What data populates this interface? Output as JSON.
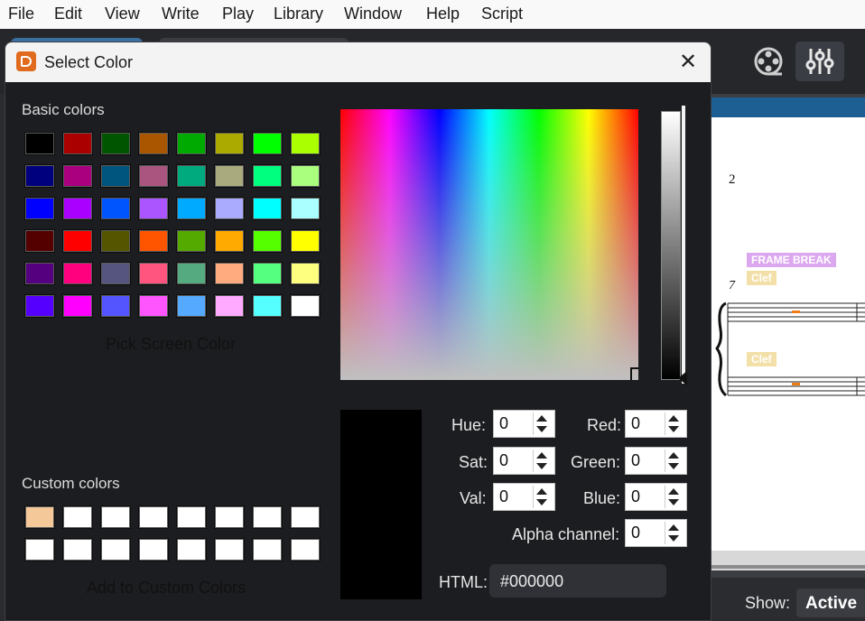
{
  "menubar": {
    "items": [
      "File",
      "Edit",
      "View",
      "Write",
      "Play",
      "Library",
      "Window",
      "Help",
      "Script"
    ]
  },
  "dialog": {
    "title": "Select Color",
    "close_icon": "close-icon",
    "basic_colors_label": "Basic colors",
    "basic_colors": [
      [
        "#000000",
        "#aa0000",
        "#005500",
        "#aa5500",
        "#00aa00",
        "#aaaa00",
        "#00ff00",
        "#aaff00"
      ],
      [
        "#00007f",
        "#aa007f",
        "#00557f",
        "#aa557f",
        "#00aa7f",
        "#aaaa7f",
        "#00ff7f",
        "#aaff7f"
      ],
      [
        "#0000ff",
        "#aa00ff",
        "#0055ff",
        "#aa55ff",
        "#00aaff",
        "#aaaaff",
        "#00ffff",
        "#aaffff"
      ],
      [
        "#550000",
        "#ff0000",
        "#555500",
        "#ff5500",
        "#55aa00",
        "#ffaa00",
        "#55ff00",
        "#ffff00"
      ],
      [
        "#55007f",
        "#ff007f",
        "#55557f",
        "#ff557f",
        "#55aa7f",
        "#ffaa7f",
        "#55ff7f",
        "#ffff7f"
      ],
      [
        "#5500ff",
        "#ff00ff",
        "#5555ff",
        "#ff55ff",
        "#55aaff",
        "#ffaaff",
        "#55ffff",
        "#ffffff"
      ]
    ],
    "pick_screen_label": "Pick Screen Color",
    "custom_colors_label": "Custom colors",
    "custom_colors": [
      [
        "#f5c89a",
        "#ffffff",
        "#ffffff",
        "#ffffff",
        "#ffffff",
        "#ffffff",
        "#ffffff",
        "#ffffff"
      ],
      [
        "#ffffff",
        "#ffffff",
        "#ffffff",
        "#ffffff",
        "#ffffff",
        "#ffffff",
        "#ffffff",
        "#ffffff"
      ]
    ],
    "add_custom_label": "Add to Custom Colors",
    "fields": {
      "hue": {
        "label": "Hue:",
        "value": "0"
      },
      "sat": {
        "label": "Sat:",
        "value": "0"
      },
      "val": {
        "label": "Val:",
        "value": "0"
      },
      "red": {
        "label": "Red:",
        "value": "0"
      },
      "green": {
        "label": "Green:",
        "value": "0"
      },
      "blue": {
        "label": "Blue:",
        "value": "0"
      },
      "alpha": {
        "label": "Alpha channel:",
        "value": "0"
      }
    },
    "html": {
      "label": "HTML:",
      "value": "#000000"
    },
    "preview_color": "#000000"
  },
  "toolbar": {
    "video_icon": "film-reel-icon",
    "mixer_icon": "mixer-sliders-icon"
  },
  "score": {
    "bar_number_top": "2",
    "bar_number_bottom": "7",
    "frame_break_label": "FRAME BREAK",
    "clef_label_1": "Clef",
    "clef_label_2": "Clef"
  },
  "showbar": {
    "label": "Show:",
    "value": "Active"
  }
}
